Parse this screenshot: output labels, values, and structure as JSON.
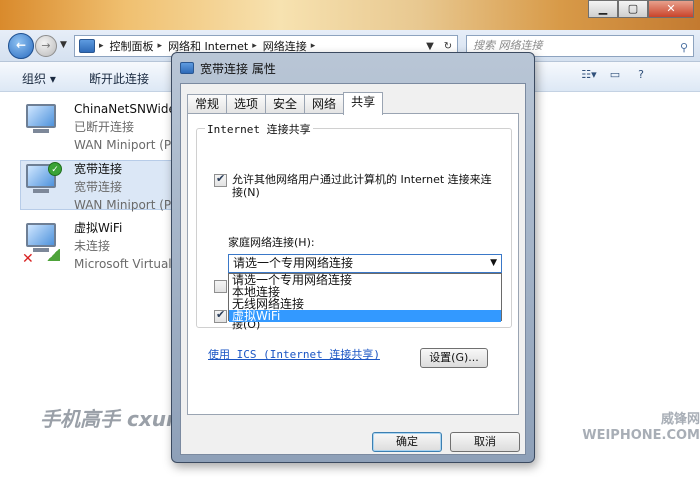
{
  "explorer": {
    "address": {
      "crumbs": [
        "控制面板",
        "网络和 Internet",
        "网络连接"
      ],
      "search_placeholder": "搜索 网络连接"
    },
    "commands": {
      "organize": "组织 ▾",
      "disconnect": "断开此连接"
    },
    "connections": [
      {
        "name": "ChinaNetSNWide",
        "status": "已断开连接",
        "device": "WAN Miniport (P"
      },
      {
        "name": "宽带连接",
        "status": "宽带连接",
        "device": "WAN Miniport (P"
      },
      {
        "name": "虚拟WiFi",
        "status": "未连接",
        "device": "Microsoft Virtual"
      }
    ]
  },
  "dialog": {
    "title": "宽带连接 属性",
    "tabs": [
      "常规",
      "选项",
      "安全",
      "网络",
      "共享"
    ],
    "active_tab": "共享",
    "group_title": "Internet 连接共享",
    "allow_share_label": "允许其他网络用户通过此计算机的 Internet 连接来连接(N)",
    "home_network_label": "家庭网络连接(H):",
    "select_value": "请选一个专用网络连接",
    "dropdown_options": [
      "请选一个专用网络连接",
      "本地连接",
      "无线网络连接",
      "虚拟WiFi"
    ],
    "highlighted_option": "虚拟WiFi",
    "third_checkbox_label_tail": "接(O)",
    "ics_link": "使用 ICS (Internet 连接共享)",
    "settings_button": "设置(G)...",
    "ok_button": "确定",
    "cancel_button": "取消"
  },
  "watermarks": {
    "left": "手机高手 cxun.cn",
    "right": "威锋网 WEIPHONE.COM"
  }
}
